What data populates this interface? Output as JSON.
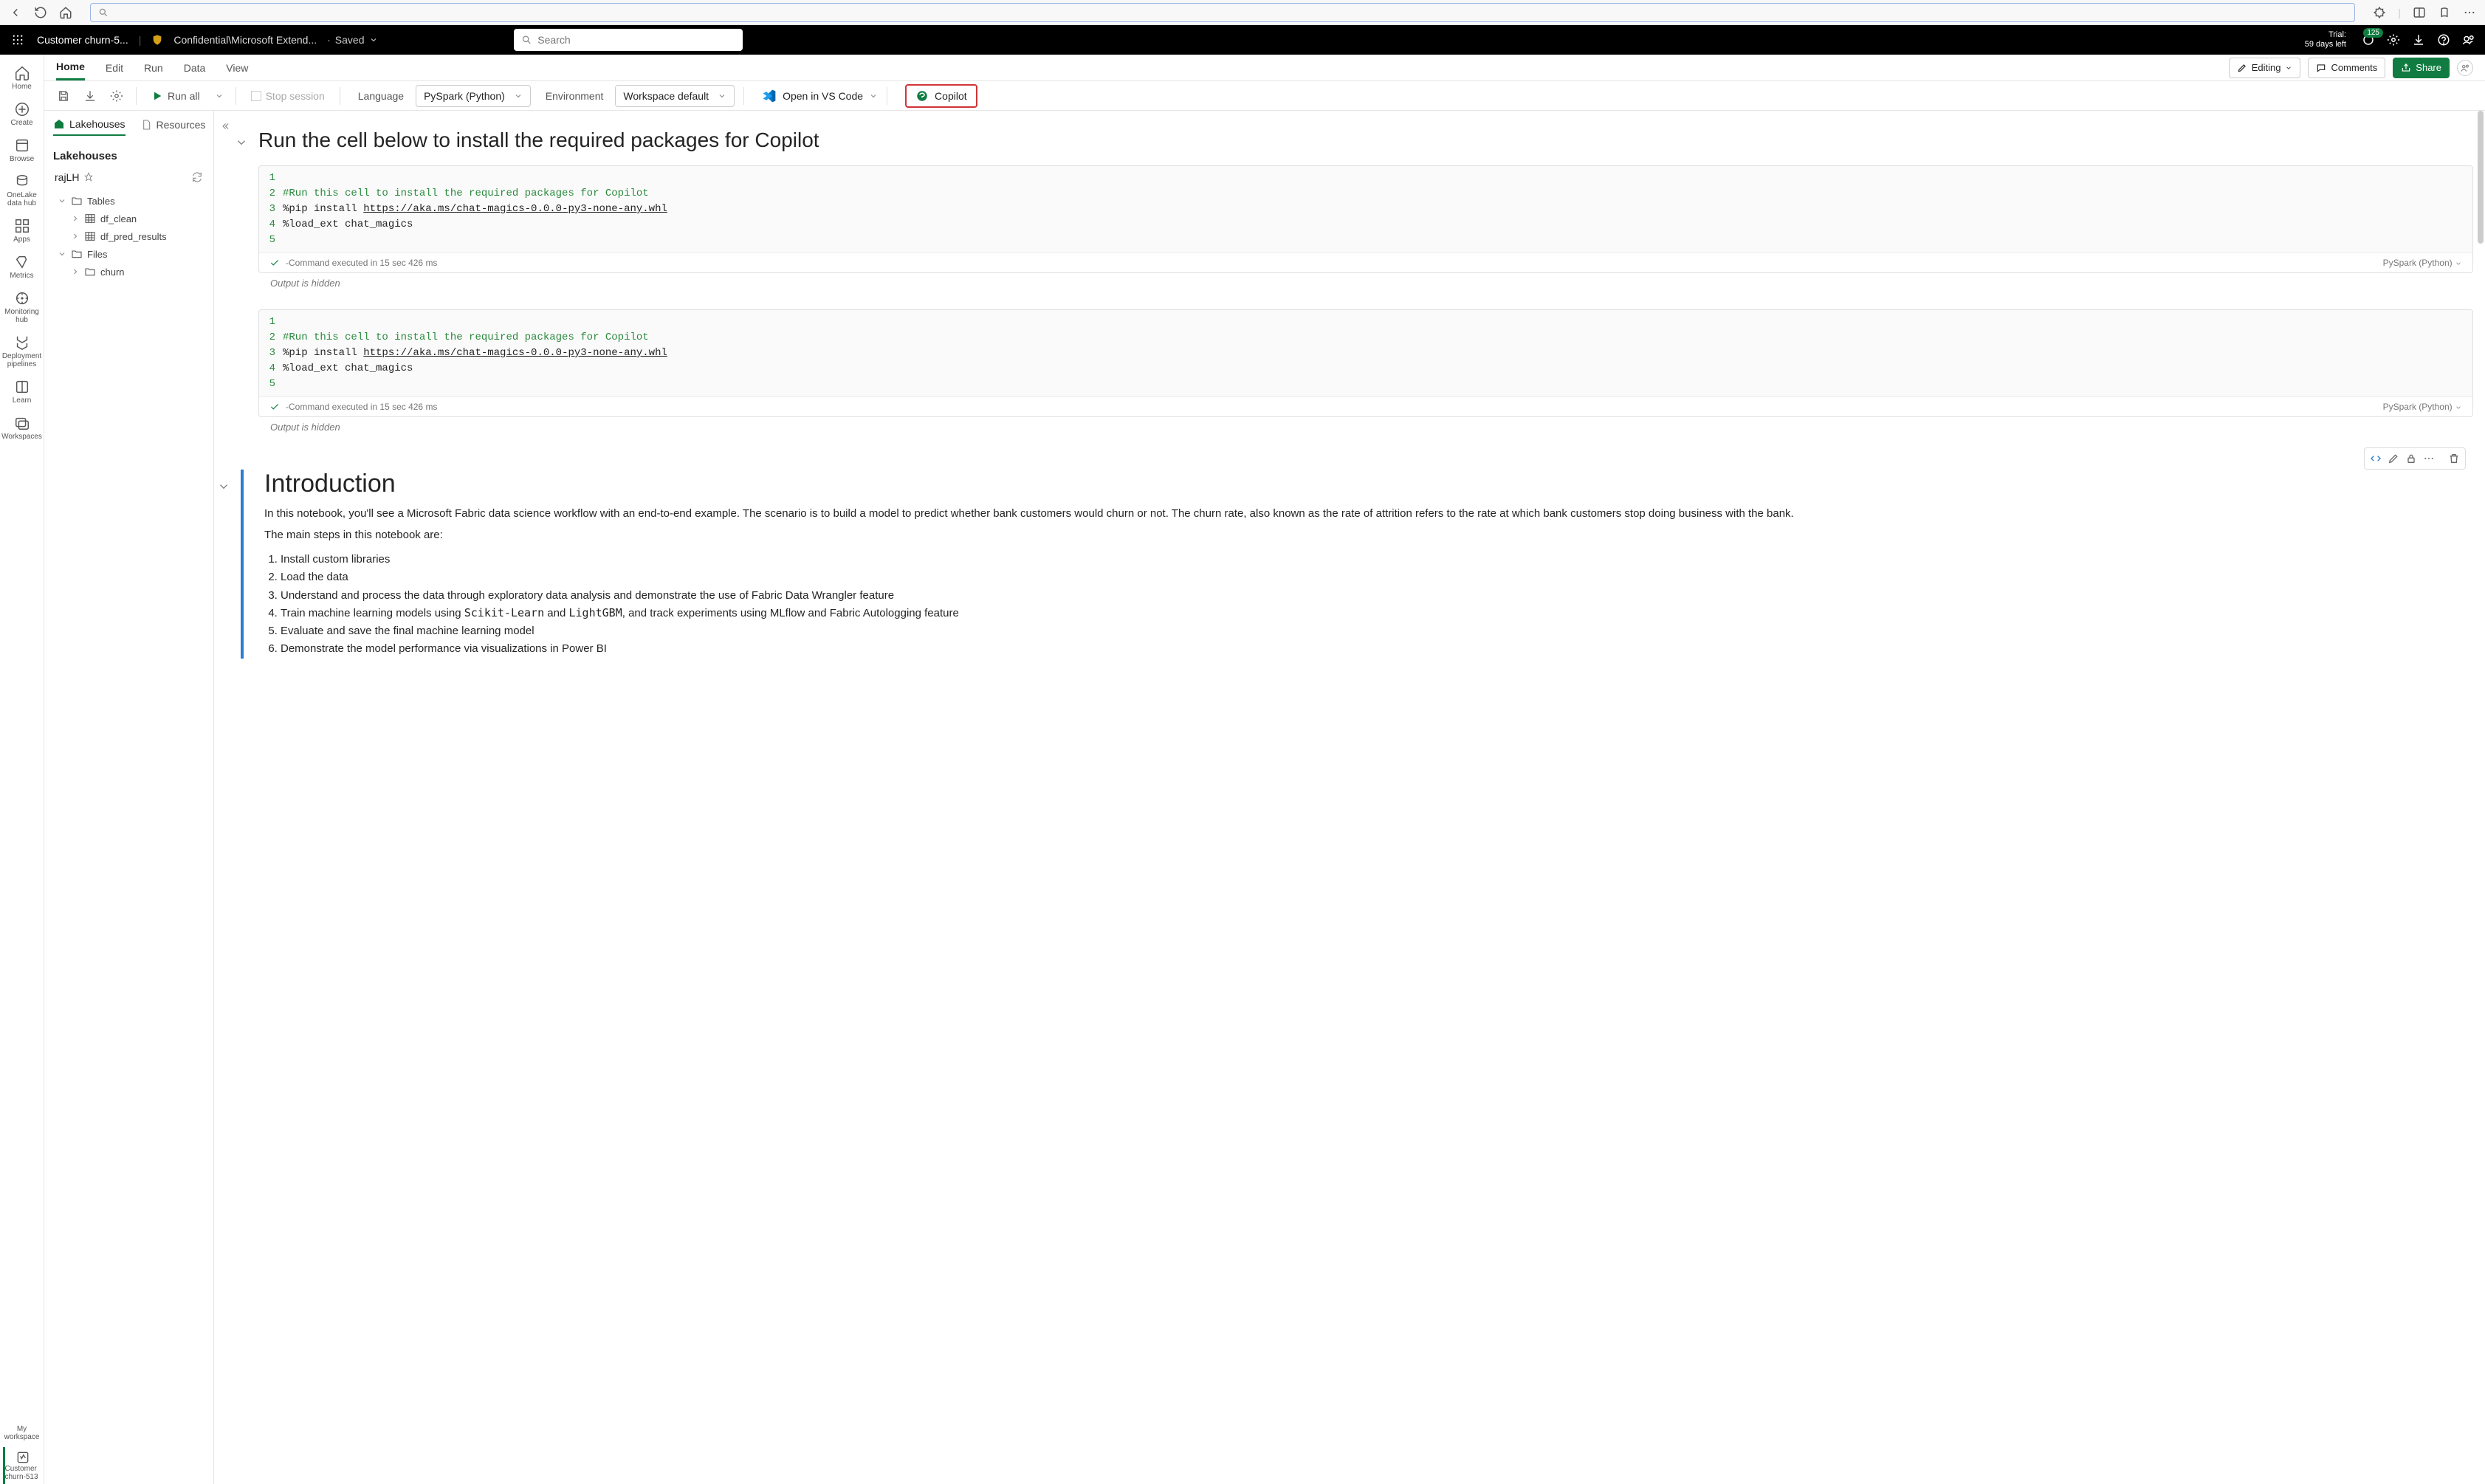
{
  "browser": {},
  "header": {
    "doc_title": "Customer churn-5...",
    "sensitivity": "Confidential\\Microsoft Extend...",
    "save_state": "Saved",
    "search_placeholder": "Search",
    "trial_label": "Trial:",
    "trial_days": "59 days left",
    "badge_count": "125"
  },
  "ribbon": {
    "tabs": {
      "home": "Home",
      "edit": "Edit",
      "run": "Run",
      "data": "Data",
      "view": "View"
    },
    "editing": "Editing",
    "comments": "Comments",
    "share": "Share"
  },
  "toolbar": {
    "run_all": "Run all",
    "stop_session": "Stop session",
    "language_label": "Language",
    "language_value": "PySpark (Python)",
    "environment_label": "Environment",
    "environment_value": "Workspace default",
    "vscode": "Open in VS Code",
    "copilot": "Copilot"
  },
  "rail": {
    "home": "Home",
    "create": "Create",
    "browse": "Browse",
    "onelake": "OneLake data hub",
    "apps": "Apps",
    "metrics": "Metrics",
    "monitor": "Monitoring hub",
    "deploy": "Deployment pipelines",
    "learn": "Learn",
    "workspaces": "Workspaces",
    "myws": "My workspace",
    "customer": "Customer churn-513"
  },
  "explorer": {
    "tab_lakehouses": "Lakehouses",
    "tab_resources": "Resources",
    "heading": "Lakehouses",
    "lakehouse_name": "rajLH",
    "tables_label": "Tables",
    "files_label": "Files",
    "tables": {
      "t1": "df_clean",
      "t2": "df_pred_results"
    },
    "files": {
      "f1": "churn"
    }
  },
  "cells": {
    "sect_title": "Run the cell below to install the required packages for Copilot",
    "code": {
      "l1": "",
      "l2": "#Run this cell to install the required packages for Copilot",
      "l3a": "%pip install ",
      "l3b": "https://aka.ms/chat-magics-0.0.0-py3-none-any.whl",
      "l4": "%load_ext chat_magics",
      "l5": ""
    },
    "exec_status": "-Command executed in 15 sec 426 ms",
    "lang_badge": "PySpark (Python)",
    "output_hidden": "Output is hidden"
  },
  "intro": {
    "title": "Introduction",
    "p1": "In this notebook, you'll see a Microsoft Fabric data science workflow with an end-to-end example. The scenario is to build a model to predict whether bank customers would churn or not. The churn rate, also known as the rate of attrition refers to the rate at which bank customers stop doing business with the bank.",
    "p2": "The main steps in this notebook are:",
    "li1": "Install custom libraries",
    "li2": "Load the data",
    "li3": "Understand and process the data through exploratory data analysis and demonstrate the use of Fabric Data Wrangler feature",
    "li4a": "Train machine learning models using ",
    "li4b": "Scikit-Learn",
    "li4c": " and ",
    "li4d": "LightGBM",
    "li4e": ", and track experiments using MLflow and Fabric Autologging feature",
    "li5": "Evaluate and save the final machine learning model",
    "li6": "Demonstrate the model performance via visualizations in Power BI"
  }
}
